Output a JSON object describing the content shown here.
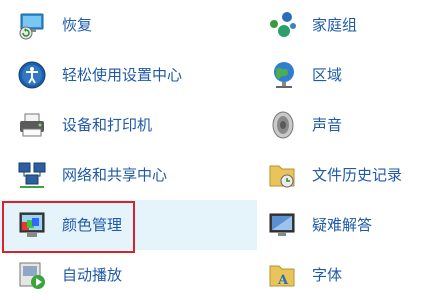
{
  "left_column": [
    {
      "label": "恢复",
      "icon": "recovery-icon"
    },
    {
      "label": "轻松使用设置中心",
      "icon": "ease-of-access-icon"
    },
    {
      "label": "设备和打印机",
      "icon": "printer-icon"
    },
    {
      "label": "网络和共享中心",
      "icon": "network-icon"
    },
    {
      "label": "颜色管理",
      "icon": "color-management-icon"
    },
    {
      "label": "自动播放",
      "icon": "autoplay-icon"
    }
  ],
  "right_column": [
    {
      "label": "家庭组",
      "icon": "homegroup-icon"
    },
    {
      "label": "区域",
      "icon": "region-icon"
    },
    {
      "label": "声音",
      "icon": "speaker-icon"
    },
    {
      "label": "文件历史记录",
      "icon": "file-history-icon"
    },
    {
      "label": "疑难解答",
      "icon": "troubleshooting-icon"
    },
    {
      "label": "字体",
      "icon": "font-folder-icon"
    }
  ],
  "highlight_color": "#e5f3fb",
  "selection_border_color": "#d9222a",
  "link_color": "#1e5aa8"
}
